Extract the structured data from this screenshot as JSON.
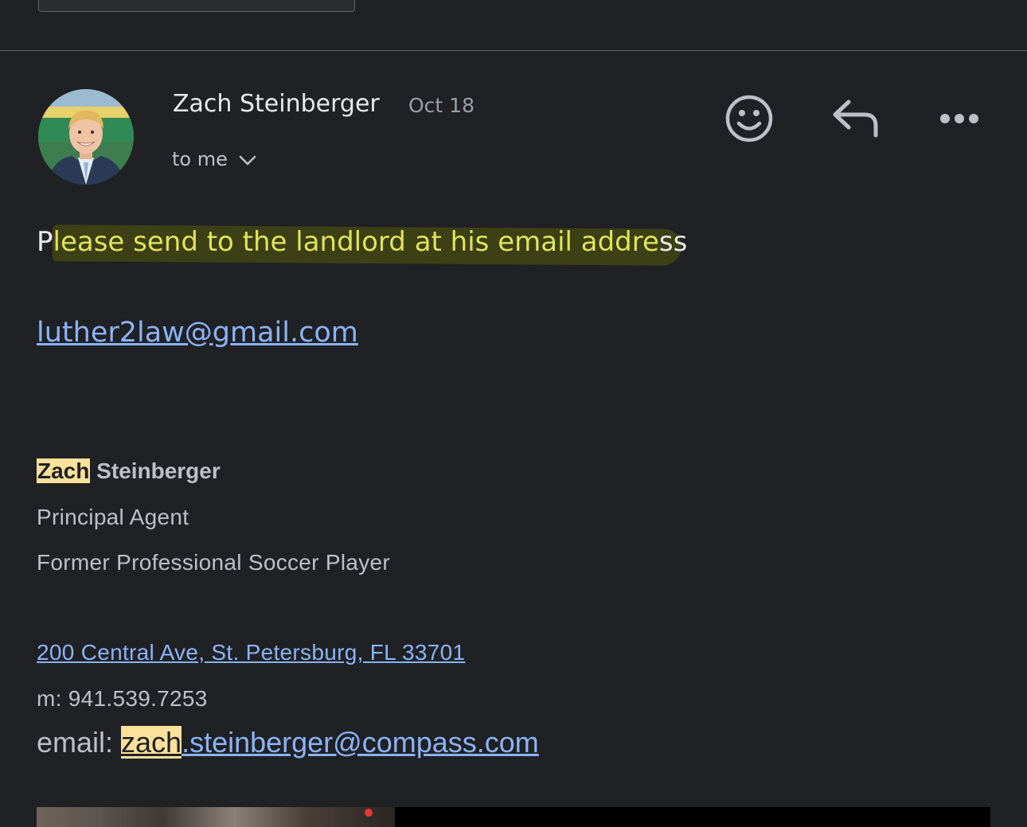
{
  "message": {
    "sender_name": "Zach Steinberger",
    "date": "Oct 18",
    "recipient": "to me",
    "body_first_letter": "P",
    "body_highlighted": "lease send to the landlord at his email addre",
    "body_rest": "ss",
    "contact_email_link": "luther2law@gmail.com"
  },
  "actions": {
    "emoji_icon": "smiley-icon",
    "reply_icon": "reply-arrow-icon",
    "more_icon": "more-dots-icon"
  },
  "signature": {
    "first_name": "Zach",
    "last_name": " Steinberger",
    "title": "Principal Agent",
    "bio": "Former Professional Soccer Player",
    "address": "200 Central Ave, St. Petersburg, FL 33701",
    "phone": "m: 941.539.7253",
    "email_label": "email: ",
    "email_user_highlight": "zach",
    "email_rest": ".steinberger@compass.com"
  },
  "colors": {
    "background": "#202124",
    "link": "#8ab4f8",
    "highlight_marker": "#dfe45a",
    "search_highlight": "#fbe19c"
  }
}
